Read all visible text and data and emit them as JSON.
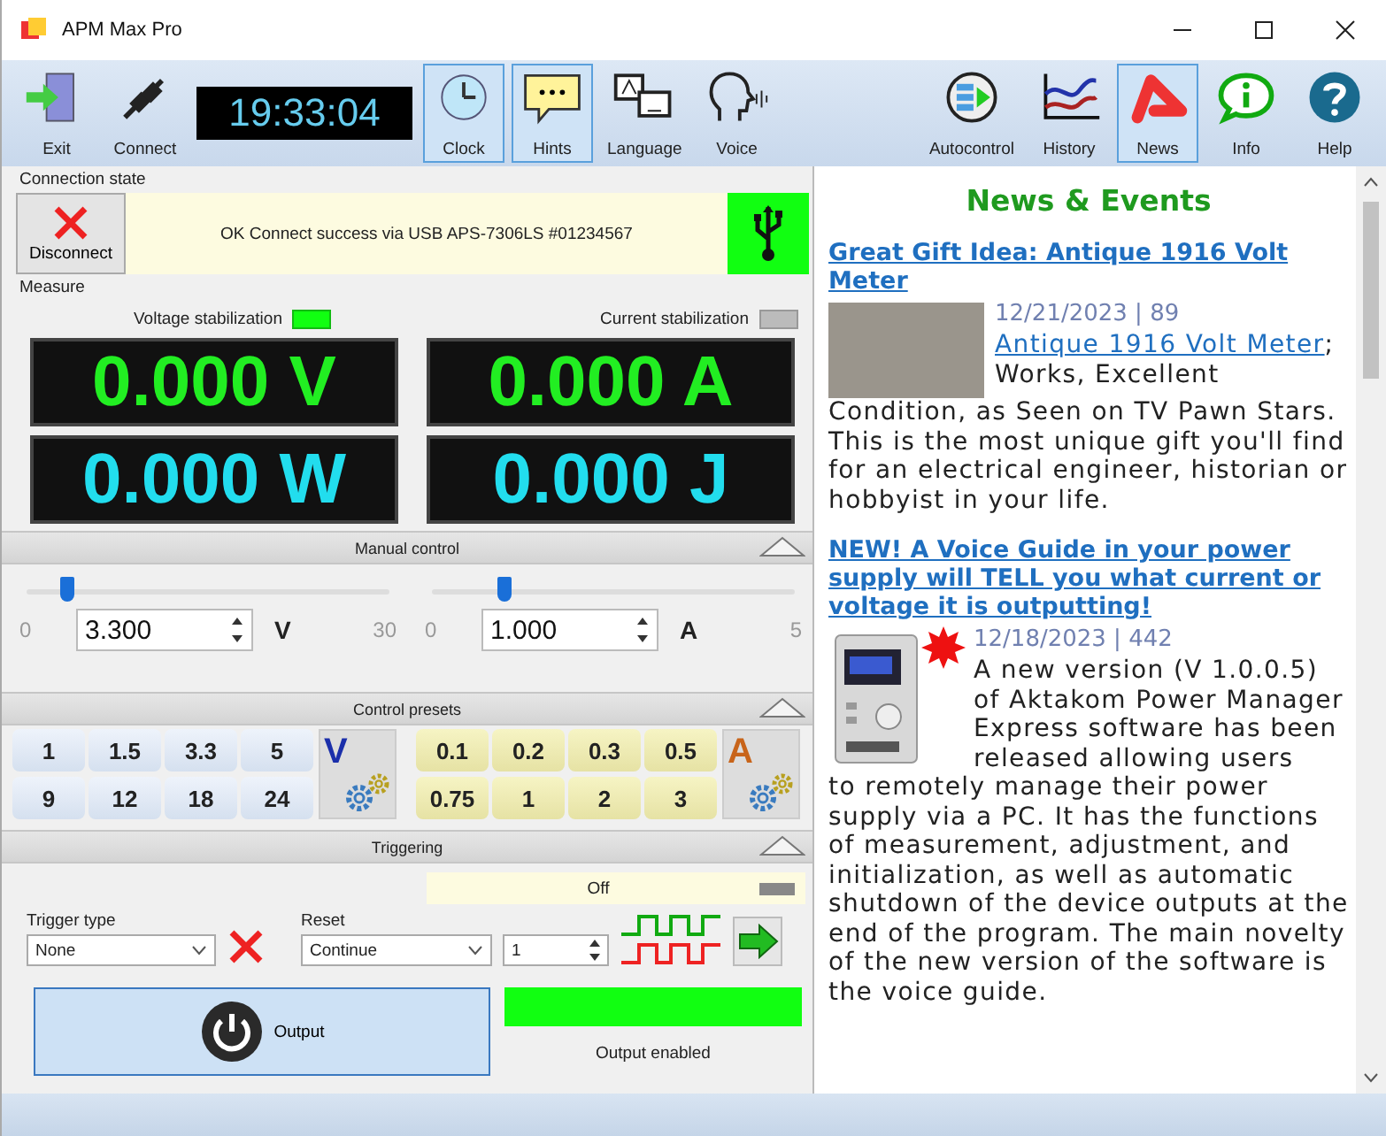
{
  "window": {
    "title": "APM Max Pro"
  },
  "toolbar": {
    "left": [
      {
        "kind": "exit",
        "label": "Exit",
        "on": false
      },
      {
        "kind": "connect",
        "label": "Connect",
        "on": false
      }
    ],
    "time": "19:33:04",
    "middle": [
      {
        "kind": "clock",
        "label": "Clock",
        "on": true
      },
      {
        "kind": "hints",
        "label": "Hints",
        "on": true
      },
      {
        "kind": "language",
        "label": "Language",
        "on": false
      },
      {
        "kind": "voice",
        "label": "Voice",
        "on": false
      }
    ],
    "right": [
      {
        "kind": "autocontrol",
        "label": "Autocontrol",
        "on": false
      },
      {
        "kind": "history",
        "label": "History",
        "on": false
      },
      {
        "kind": "news",
        "label": "News",
        "on": true
      },
      {
        "kind": "info",
        "label": "Info",
        "on": false
      },
      {
        "kind": "help",
        "label": "Help",
        "on": false
      }
    ]
  },
  "connection": {
    "label": "Connection state",
    "disconnect": "Disconnect",
    "message": "OK Connect success via USB APS-7306LS #01234567",
    "connected": true
  },
  "measure": {
    "label": "Measure",
    "stabilization": [
      {
        "label": "Voltage stabilization",
        "on": true
      },
      {
        "label": "Current stabilization",
        "on": false
      }
    ],
    "readings": [
      {
        "value": "0.000 V",
        "kind": "measured"
      },
      {
        "value": "0.000 A",
        "kind": "measured"
      },
      {
        "value": "0.000 W",
        "kind": "derived"
      },
      {
        "value": "0.000 J",
        "kind": "derived"
      }
    ]
  },
  "manual_control": {
    "title": "Manual control",
    "expanded": true,
    "channels": [
      {
        "min": "0",
        "max": "30",
        "value": "3.300",
        "unit": "V",
        "level": 0.11
      },
      {
        "min": "0",
        "max": "5",
        "value": "1.000",
        "unit": "A",
        "level": 0.2
      }
    ]
  },
  "presets": {
    "title": "Control presets",
    "expanded": true,
    "groups": [
      {
        "kind": "voltage",
        "unit": "V",
        "values": [
          "1",
          "1.5",
          "3.3",
          "5",
          "9",
          "12",
          "18",
          "24"
        ]
      },
      {
        "kind": "current",
        "unit": "A",
        "values": [
          "0.1",
          "0.2",
          "0.3",
          "0.5",
          "0.75",
          "1",
          "2",
          "3"
        ]
      }
    ]
  },
  "triggering": {
    "title": "Triggering",
    "expanded": true,
    "status": "Off",
    "active": false,
    "trigger_type": {
      "label": "Trigger type",
      "value": "None"
    },
    "reset": {
      "label": "Reset",
      "value": "Continue"
    },
    "count": "1"
  },
  "output": {
    "label": "Output",
    "status": "Output enabled",
    "enabled": true
  },
  "news": {
    "title": "News & Events",
    "articles": [
      {
        "kind": "photo",
        "title": "Great Gift Idea: Antique 1916 Volt Meter",
        "meta": "12/21/2023 | 89",
        "link": "Antique 1916 Volt Meter",
        "lead": "; Works, Excellent",
        "text": "Condition, as Seen on TV Pawn Stars. This is the most unique gift you'll find for an electrical engineer, historian or hobbyist in your life."
      },
      {
        "kind": "product",
        "title": "NEW! A Voice Guide in your power supply will TELL you what current or voltage it is outputting!",
        "meta": "12/18/2023 | 442",
        "lead": "A new version (V 1.0.0.5) of Aktakom Power Manager Express software has been released allowing users",
        "text": "to remotely manage their power supply via a PC. It has the functions of measurement, adjustment, and initialization, as well as automatic shutdown of the device outputs at the end of the program. The main novelty of the new version of the software is the voice guide."
      }
    ]
  }
}
